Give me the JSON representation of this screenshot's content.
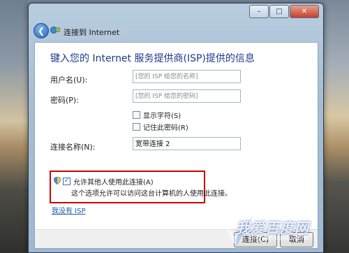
{
  "window": {
    "title": "连接到 Internet",
    "caption_buttons": {
      "minimize": "–",
      "maximize": "□",
      "close": "✕"
    }
  },
  "content": {
    "heading": "键入您的 Internet 服务提供商(ISP)提供的信息",
    "username": {
      "label": "用户名(U):",
      "placeholder": "[您的 ISP 给您的名称]"
    },
    "password": {
      "label": "密码(P):",
      "placeholder": "[您的 ISP 给您的密码]"
    },
    "show_chars": "显示字符(S)",
    "remember_pw": "记住此密码(R)",
    "conn_name": {
      "label": "连接名称(N):",
      "value": "宽带连接 2"
    },
    "allow_others": "允许其他人使用此连接(A)",
    "allow_desc": "这个选项允许可以访问这台计算机的人使用此连接。",
    "no_isp": "我没有 ISP"
  },
  "footer": {
    "connect": "连接(C)",
    "cancel": "取消"
  },
  "watermark": {
    "main": "我爱百度网",
    "sub": "jingyan.baidu.com"
  },
  "colors": {
    "heading": "#1e3a8a",
    "highlight": "#cc0000",
    "link": "#1f5bb5"
  }
}
